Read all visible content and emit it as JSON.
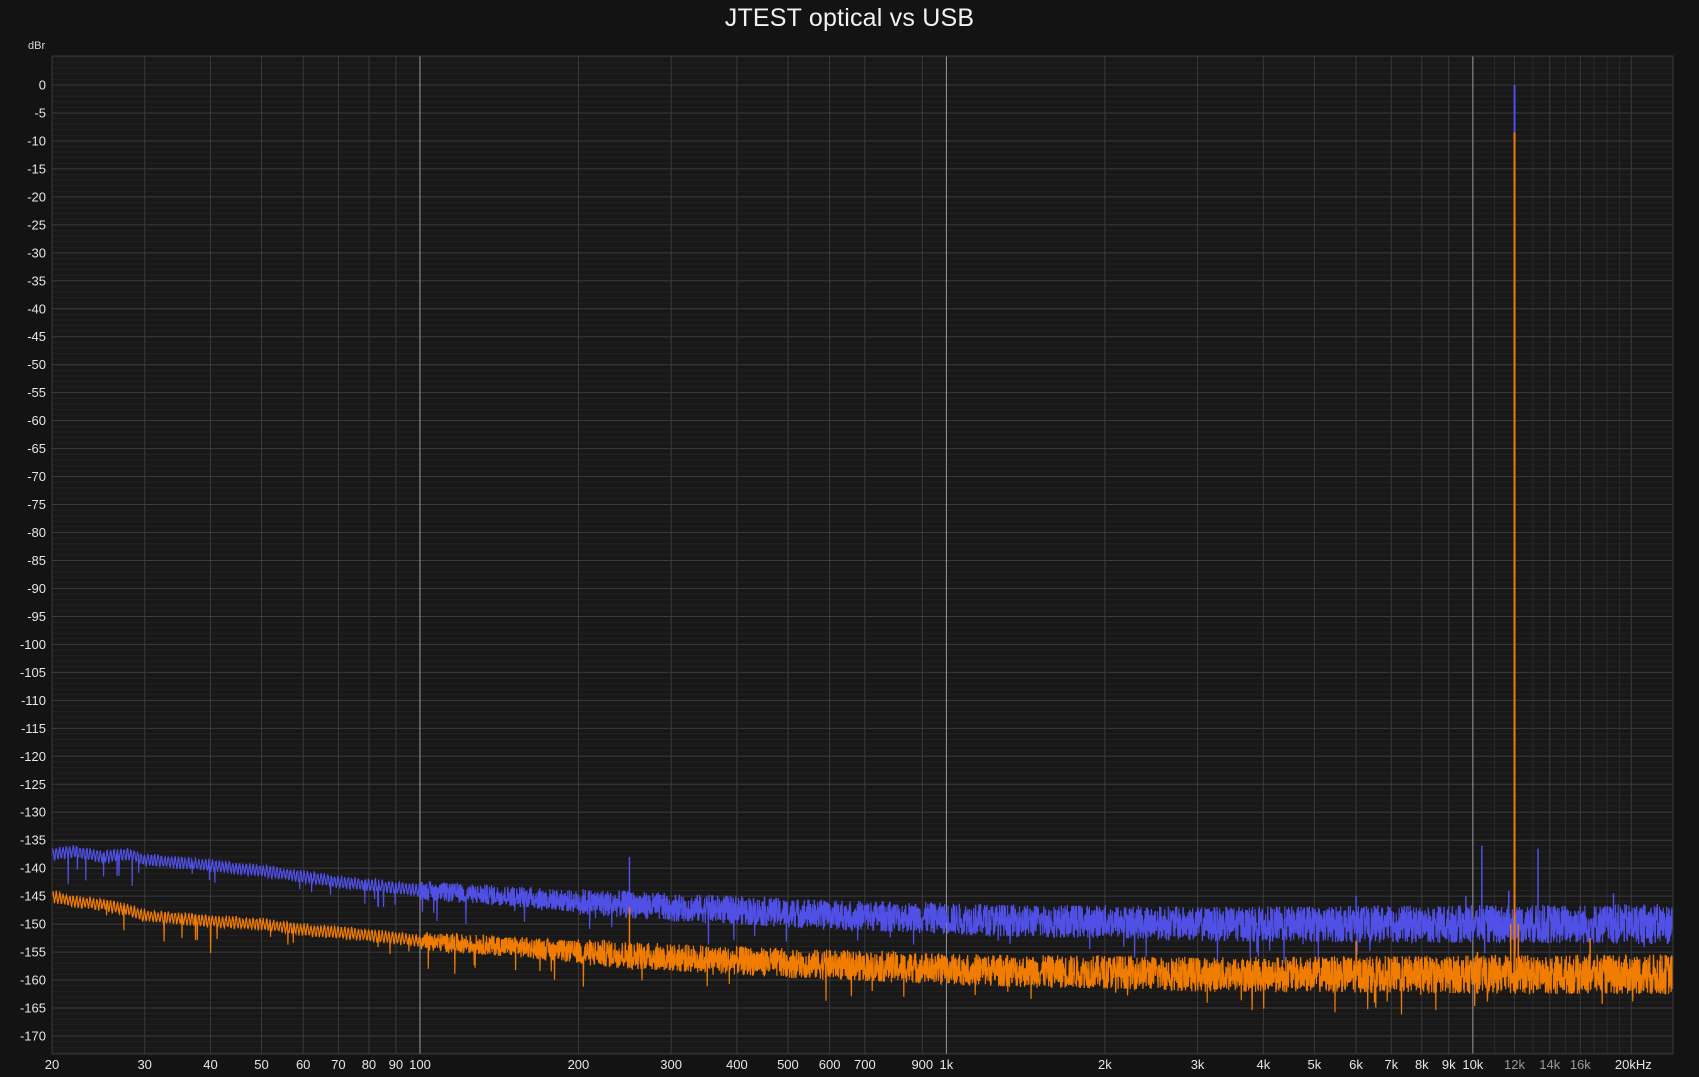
{
  "chart_data": {
    "type": "line",
    "title": "JTEST optical vs USB",
    "ylabel": "dBr",
    "xlabel": "",
    "x_scale": "log",
    "xlim": [
      20,
      24000
    ],
    "ylim": [
      -175,
      5
    ],
    "grid": true,
    "y_ticks": [
      0,
      -5,
      -10,
      -15,
      -20,
      -25,
      -30,
      -35,
      -40,
      -45,
      -50,
      -55,
      -60,
      -65,
      -70,
      -75,
      -80,
      -85,
      -90,
      -95,
      -100,
      -105,
      -110,
      -115,
      -120,
      -125,
      -130,
      -135,
      -140,
      -145,
      -150,
      -155,
      -160,
      -165,
      -170
    ],
    "y_tick_labels": [
      "0",
      "-5",
      "-10",
      "-15",
      "-20",
      "-25",
      "-30",
      "-35",
      "-40",
      "-45",
      "-50",
      "-55",
      "-60",
      "-65",
      "-70",
      "-75",
      "-80",
      "-85",
      "-90",
      "-95",
      "-100",
      "-105",
      "-110",
      "-115",
      "-120",
      "-125",
      "-130",
      "-135",
      "-140",
      "-145",
      "-150",
      "-155",
      "-160",
      "-165",
      "-170"
    ],
    "x_ticks": [
      20,
      30,
      40,
      50,
      60,
      70,
      80,
      90,
      100,
      200,
      300,
      400,
      500,
      600,
      700,
      900,
      1000,
      2000,
      3000,
      4000,
      5000,
      6000,
      7000,
      8000,
      9000,
      10000,
      12000,
      14000,
      16000,
      20000
    ],
    "x_tick_labels": [
      "20",
      "30",
      "40",
      "50",
      "60",
      "70",
      "80",
      "90",
      "100",
      "200",
      "300",
      "400",
      "500",
      "600",
      "700",
      "900",
      "1k",
      "2k",
      "3k",
      "4k",
      "5k",
      "6k",
      "7k",
      "8k",
      "9k",
      "10k",
      "12k",
      "14k",
      "16k",
      "20kHz"
    ],
    "series": [
      {
        "color": "#5050e6",
        "x": [
          20,
          22,
          25,
          28,
          30,
          35,
          40,
          50,
          60,
          70,
          80,
          90,
          100,
          120,
          150,
          200,
          250,
          300,
          400,
          500,
          700,
          1000,
          1500,
          2000,
          3000,
          5000,
          7000,
          10000,
          15000,
          20000,
          24000
        ],
        "y": [
          -137.5,
          -137,
          -138,
          -137.5,
          -138.5,
          -139,
          -139.5,
          -140.5,
          -141.5,
          -142.5,
          -143,
          -143.5,
          -144,
          -144.5,
          -145,
          -146,
          -146.5,
          -147,
          -147.5,
          -148,
          -148.5,
          -149,
          -149.5,
          -149.5,
          -150,
          -150,
          -150,
          -150,
          -150,
          -150,
          -150
        ],
        "peaks": [
          {
            "x": 250,
            "y": -138
          },
          {
            "x": 10400,
            "y": -136
          },
          {
            "x": 11700,
            "y": -144
          },
          {
            "x": 12000,
            "y": 0
          },
          {
            "x": 13300,
            "y": -136.5
          },
          {
            "x": 9700,
            "y": -145
          },
          {
            "x": 18500,
            "y": -144.5
          },
          {
            "x": 6000,
            "y": -145
          }
        ]
      },
      {
        "color": "#f07c00",
        "x": [
          20,
          22,
          25,
          28,
          30,
          35,
          40,
          50,
          60,
          70,
          80,
          90,
          100,
          120,
          150,
          200,
          250,
          300,
          400,
          500,
          700,
          1000,
          1500,
          2000,
          3000,
          5000,
          7000,
          10000,
          15000,
          20000,
          24000
        ],
        "y": [
          -145,
          -146,
          -146.5,
          -147.5,
          -148.5,
          -149,
          -149.5,
          -150,
          -151,
          -151.5,
          -152,
          -152.5,
          -153,
          -153.5,
          -154,
          -155,
          -155.5,
          -156,
          -156.5,
          -157,
          -157.5,
          -158,
          -158.5,
          -158.5,
          -159,
          -159,
          -159,
          -159,
          -159,
          -159,
          -159
        ],
        "peaks": [
          {
            "x": 250,
            "y": -147
          },
          {
            "x": 12000,
            "y": -8.5
          },
          {
            "x": 11800,
            "y": -150
          },
          {
            "x": 12200,
            "y": -150
          },
          {
            "x": 6000,
            "y": -153
          },
          {
            "x": 16700,
            "y": -152.5
          },
          {
            "x": 10200,
            "y": -155
          }
        ]
      }
    ]
  }
}
